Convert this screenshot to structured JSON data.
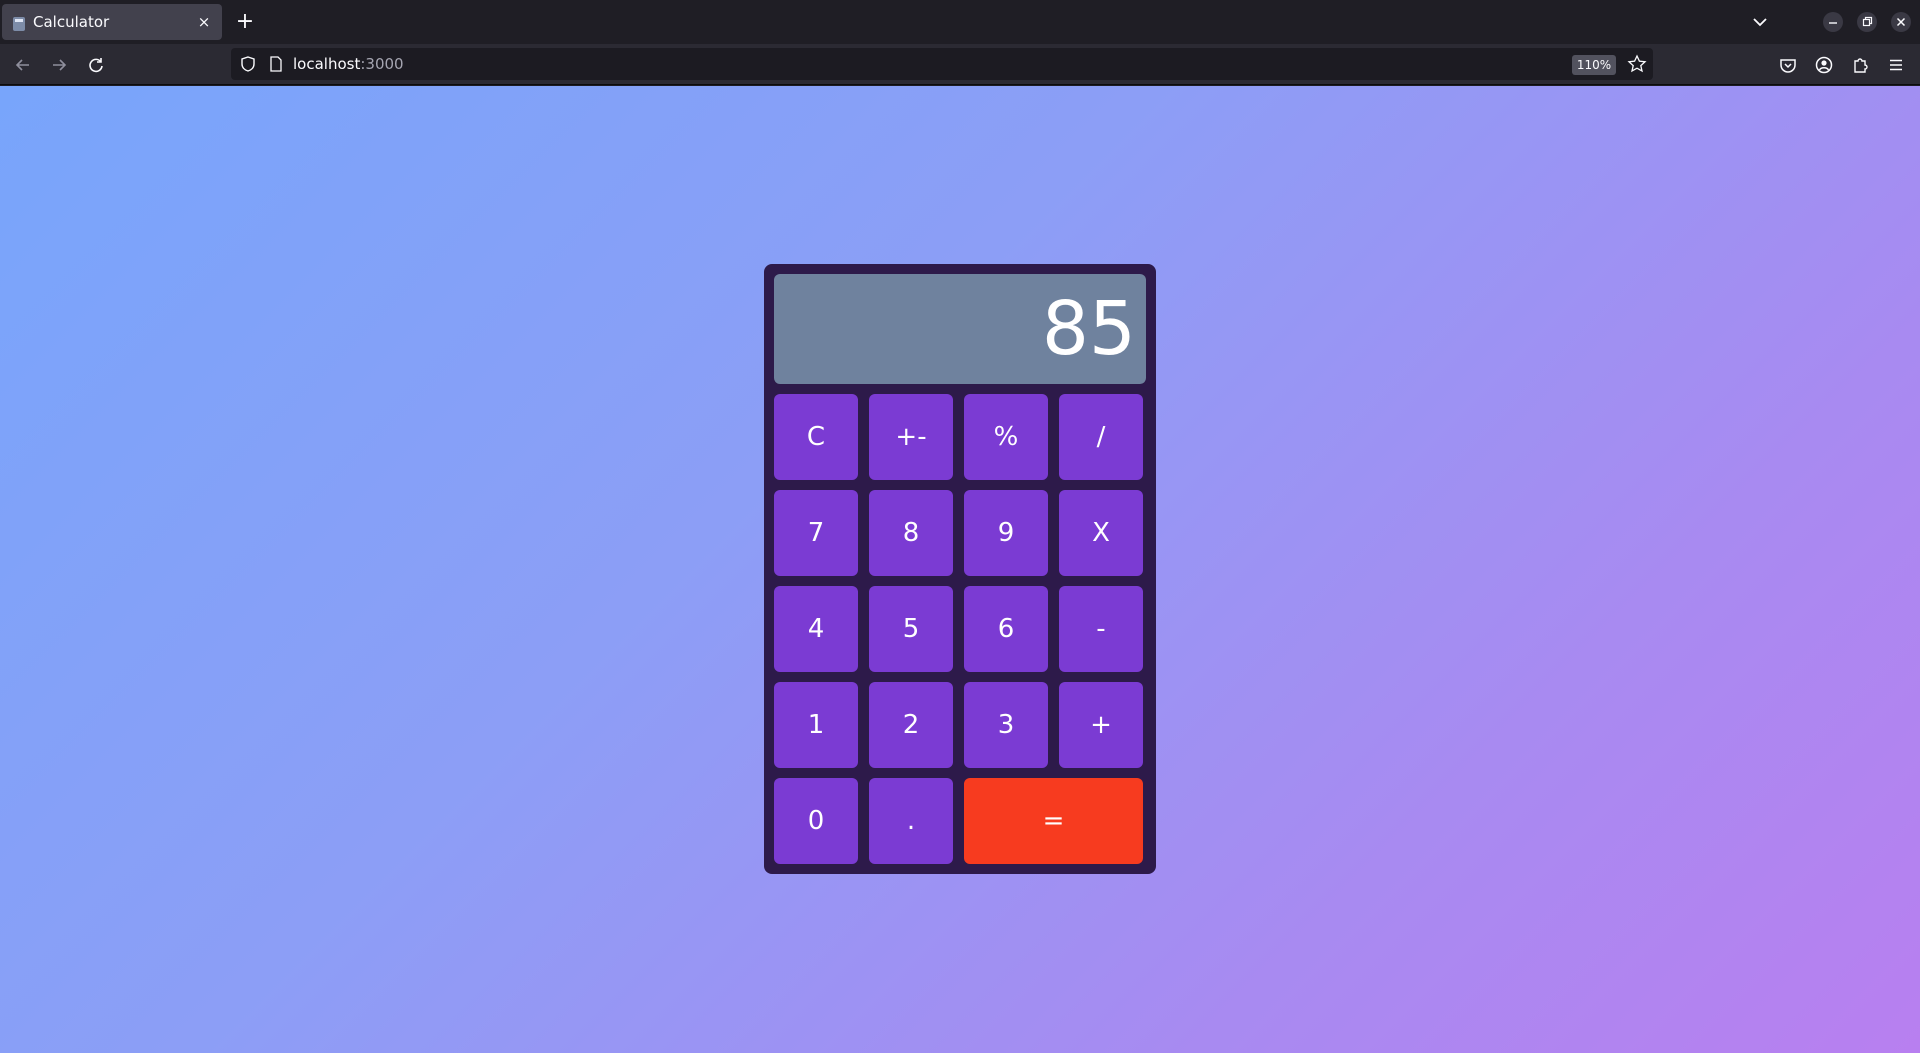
{
  "browser": {
    "tab_title": "Calculator",
    "tab_close": "×",
    "new_tab": "+",
    "url_host": "localhost",
    "url_port": ":3000",
    "zoom": "110%"
  },
  "calculator": {
    "display": "85",
    "keys": [
      "C",
      "+-",
      "%",
      "/",
      "7",
      "8",
      "9",
      "X",
      "4",
      "5",
      "6",
      "-",
      "1",
      "2",
      "3",
      "+",
      "0",
      ".",
      "="
    ]
  },
  "colors": {
    "gradient_start": "#78a5fb",
    "gradient_end": "#b87ff0",
    "calculator_body": "#2d1a4a",
    "display_bg": "#6f829e",
    "key": "#7b3bd3",
    "equals_key": "#f73b1f"
  }
}
